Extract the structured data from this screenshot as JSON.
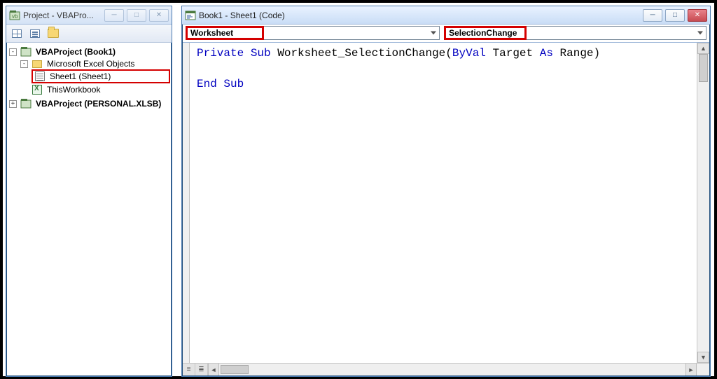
{
  "project_window": {
    "title": "Project - VBAPro...",
    "toolbar": {
      "view_code": "view-code",
      "view_object": "view-object",
      "toggle_folders": "toggle-folders"
    }
  },
  "tree": {
    "root1": {
      "label": "VBAProject (Book1)",
      "expander": "-"
    },
    "mso": {
      "label": "Microsoft Excel Objects",
      "expander": "-"
    },
    "sheet1": {
      "label": "Sheet1 (Sheet1)"
    },
    "thiswb": {
      "label": "ThisWorkbook"
    },
    "root2": {
      "label": "VBAProject (PERSONAL.XLSB)",
      "expander": "+"
    }
  },
  "code_window": {
    "title": "Book1 - Sheet1 (Code)",
    "object_dropdown": "Worksheet",
    "procedure_dropdown": "SelectionChange"
  },
  "code": {
    "line1_kw1": "Private",
    "line1_kw2": "Sub",
    "line1_name": " Worksheet_SelectionChange(",
    "line1_kw3": "ByVal",
    "line1_mid": " Target ",
    "line1_kw4": "As",
    "line1_end": " Range)",
    "line2_kw1": "End",
    "line2_kw2": "Sub"
  },
  "glyphs": {
    "min": "─",
    "max": "□",
    "close": "✕",
    "up": "▲",
    "down": "▼",
    "left": "◄",
    "right": "►",
    "proc_view": "≡",
    "full_view": "≣"
  }
}
